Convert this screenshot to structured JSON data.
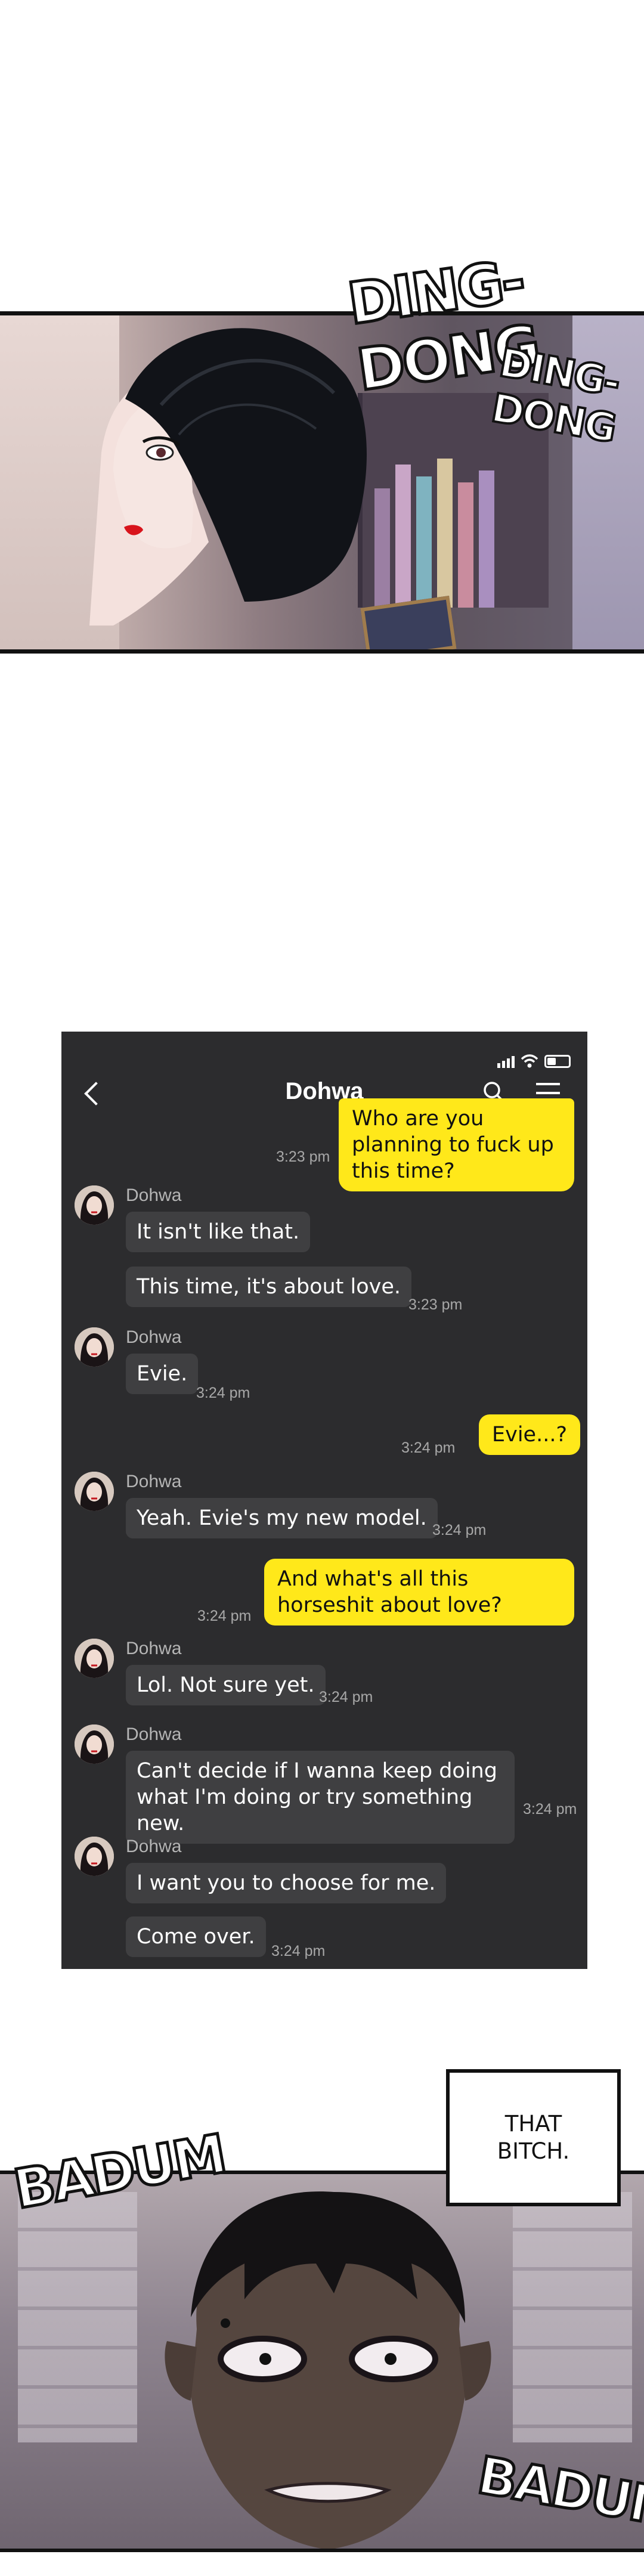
{
  "panel1": {
    "sfx_main": "DING-DONG",
    "sfx_echo": "DING-DONG"
  },
  "phone": {
    "header": {
      "title": "Dohwa",
      "back_icon": "chevron-left-icon",
      "search_icon": "search-icon",
      "menu_icon": "menu-icon",
      "status_icons": [
        "signal-icon",
        "wifi-icon",
        "battery-icon"
      ]
    },
    "messages": [
      {
        "from": "me",
        "text": "Who are you planning to fuck up this time?",
        "time": "3:23 pm"
      },
      {
        "from": "Dohwa",
        "name": "Dohwa",
        "text": "It isn't like that.",
        "time": ""
      },
      {
        "from": "Dohwa",
        "text": "This time, it's about love.",
        "time": "3:23 pm"
      },
      {
        "from": "Dohwa",
        "name": "Dohwa",
        "text": "Evie.",
        "time": "3:24 pm"
      },
      {
        "from": "me",
        "text": "Evie...?",
        "time": "3:24 pm"
      },
      {
        "from": "Dohwa",
        "name": "Dohwa",
        "text": "Yeah. Evie's my new model.",
        "time": "3:24 pm"
      },
      {
        "from": "me",
        "text": "And what's all this horseshit about love?",
        "time": "3:24 pm"
      },
      {
        "from": "Dohwa",
        "name": "Dohwa",
        "text": "Lol. Not sure yet.",
        "time": "3:24 pm"
      },
      {
        "from": "Dohwa",
        "name": "Dohwa",
        "text": "Can't decide if I wanna keep doing what I'm doing or try something new.",
        "time": "3:24 pm"
      },
      {
        "from": "Dohwa",
        "name": "Dohwa",
        "text": "I want you to choose for me.",
        "time": ""
      },
      {
        "from": "Dohwa",
        "text": "Come over.",
        "time": "3:24 pm"
      }
    ]
  },
  "panel3": {
    "caption": "THAT BITCH.",
    "sfx_left": "BADUM",
    "sfx_right": "BADUM"
  }
}
